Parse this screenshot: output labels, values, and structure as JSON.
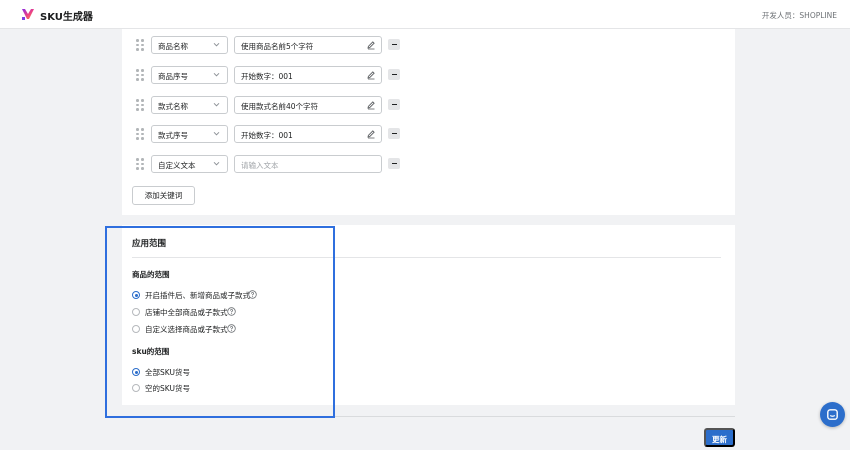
{
  "header": {
    "app_title": "SKU生成器",
    "developer": "开发人员：SHOPLINE",
    "logo_icon": "sku-generator-logo-icon"
  },
  "keyword_rows": [
    {
      "type": "商品名称",
      "value": "使用商品名前5个字符",
      "editable": true
    },
    {
      "type": "商品序号",
      "value": "开始数字：001",
      "editable": true
    },
    {
      "type": "款式名称",
      "value": "使用款式名前40个字符",
      "editable": true
    },
    {
      "type": "款式序号",
      "value": "开始数字：001",
      "editable": true
    },
    {
      "type": "自定义文本",
      "value": "",
      "placeholder": "请输入文本",
      "editable": false
    }
  ],
  "add_keyword_label": "添加关键词",
  "scope": {
    "title": "应用范围",
    "product_scope": {
      "title": "商品的范围",
      "options": [
        {
          "label": "开启插件后、新增商品或子款式",
          "checked": true
        },
        {
          "label": "店铺中全部商品或子款式",
          "checked": false
        },
        {
          "label": "自定义选择商品或子款式",
          "checked": false
        }
      ]
    },
    "sku_scope": {
      "title": "sku的范围",
      "options": [
        {
          "label": "全部SKU货号",
          "checked": true
        },
        {
          "label": "空的SKU货号",
          "checked": false
        }
      ]
    }
  },
  "update_label": "更新",
  "colors": {
    "primary": "#2c6ecb",
    "highlight_border": "#2f6fde",
    "page_bg": "#f1f2f4"
  },
  "icons": {
    "drag": "drag-handle-icon",
    "chevron": "chevron-down-icon",
    "edit": "pencil-icon",
    "remove": "minus-icon",
    "help": "question-circle-icon",
    "chat": "chat-icon"
  }
}
